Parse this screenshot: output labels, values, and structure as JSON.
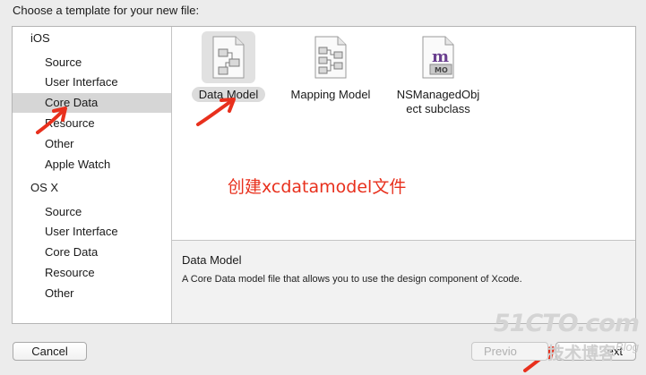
{
  "dialog": {
    "heading": "Choose a template for your new file:"
  },
  "sidebar": {
    "ios_label": "iOS",
    "ios_items": [
      "Source",
      "User Interface",
      "Core Data",
      "Resource",
      "Other",
      "Apple Watch"
    ],
    "osx_label": "OS X",
    "osx_items": [
      "Source",
      "User Interface",
      "Core Data",
      "Resource",
      "Other"
    ],
    "selected": "iOS / Core Data"
  },
  "templates": [
    {
      "label": "Data Model",
      "icon": "data-model-document-icon",
      "selected": true
    },
    {
      "label": "Mapping Model",
      "icon": "mapping-model-document-icon",
      "selected": false
    },
    {
      "label": "NSManagedObject subclass",
      "label_line1": "NSManagedObj",
      "label_line2": "ect subclass",
      "icon": "managed-object-subclass-icon",
      "selected": false
    }
  ],
  "annotation": "创建xcdatamodel文件",
  "description": {
    "title": "Data Model",
    "body": "A Core Data model file that allows you to use the design component of Xcode."
  },
  "buttons": {
    "cancel": "Cancel",
    "previous": "Previo",
    "next": "ext"
  },
  "watermark": {
    "logo": "51CTO.com",
    "sub": "技术博客",
    "blog": "Blog"
  },
  "colors": {
    "annotation": "#e8301d",
    "selection": "#d6d6d6"
  }
}
